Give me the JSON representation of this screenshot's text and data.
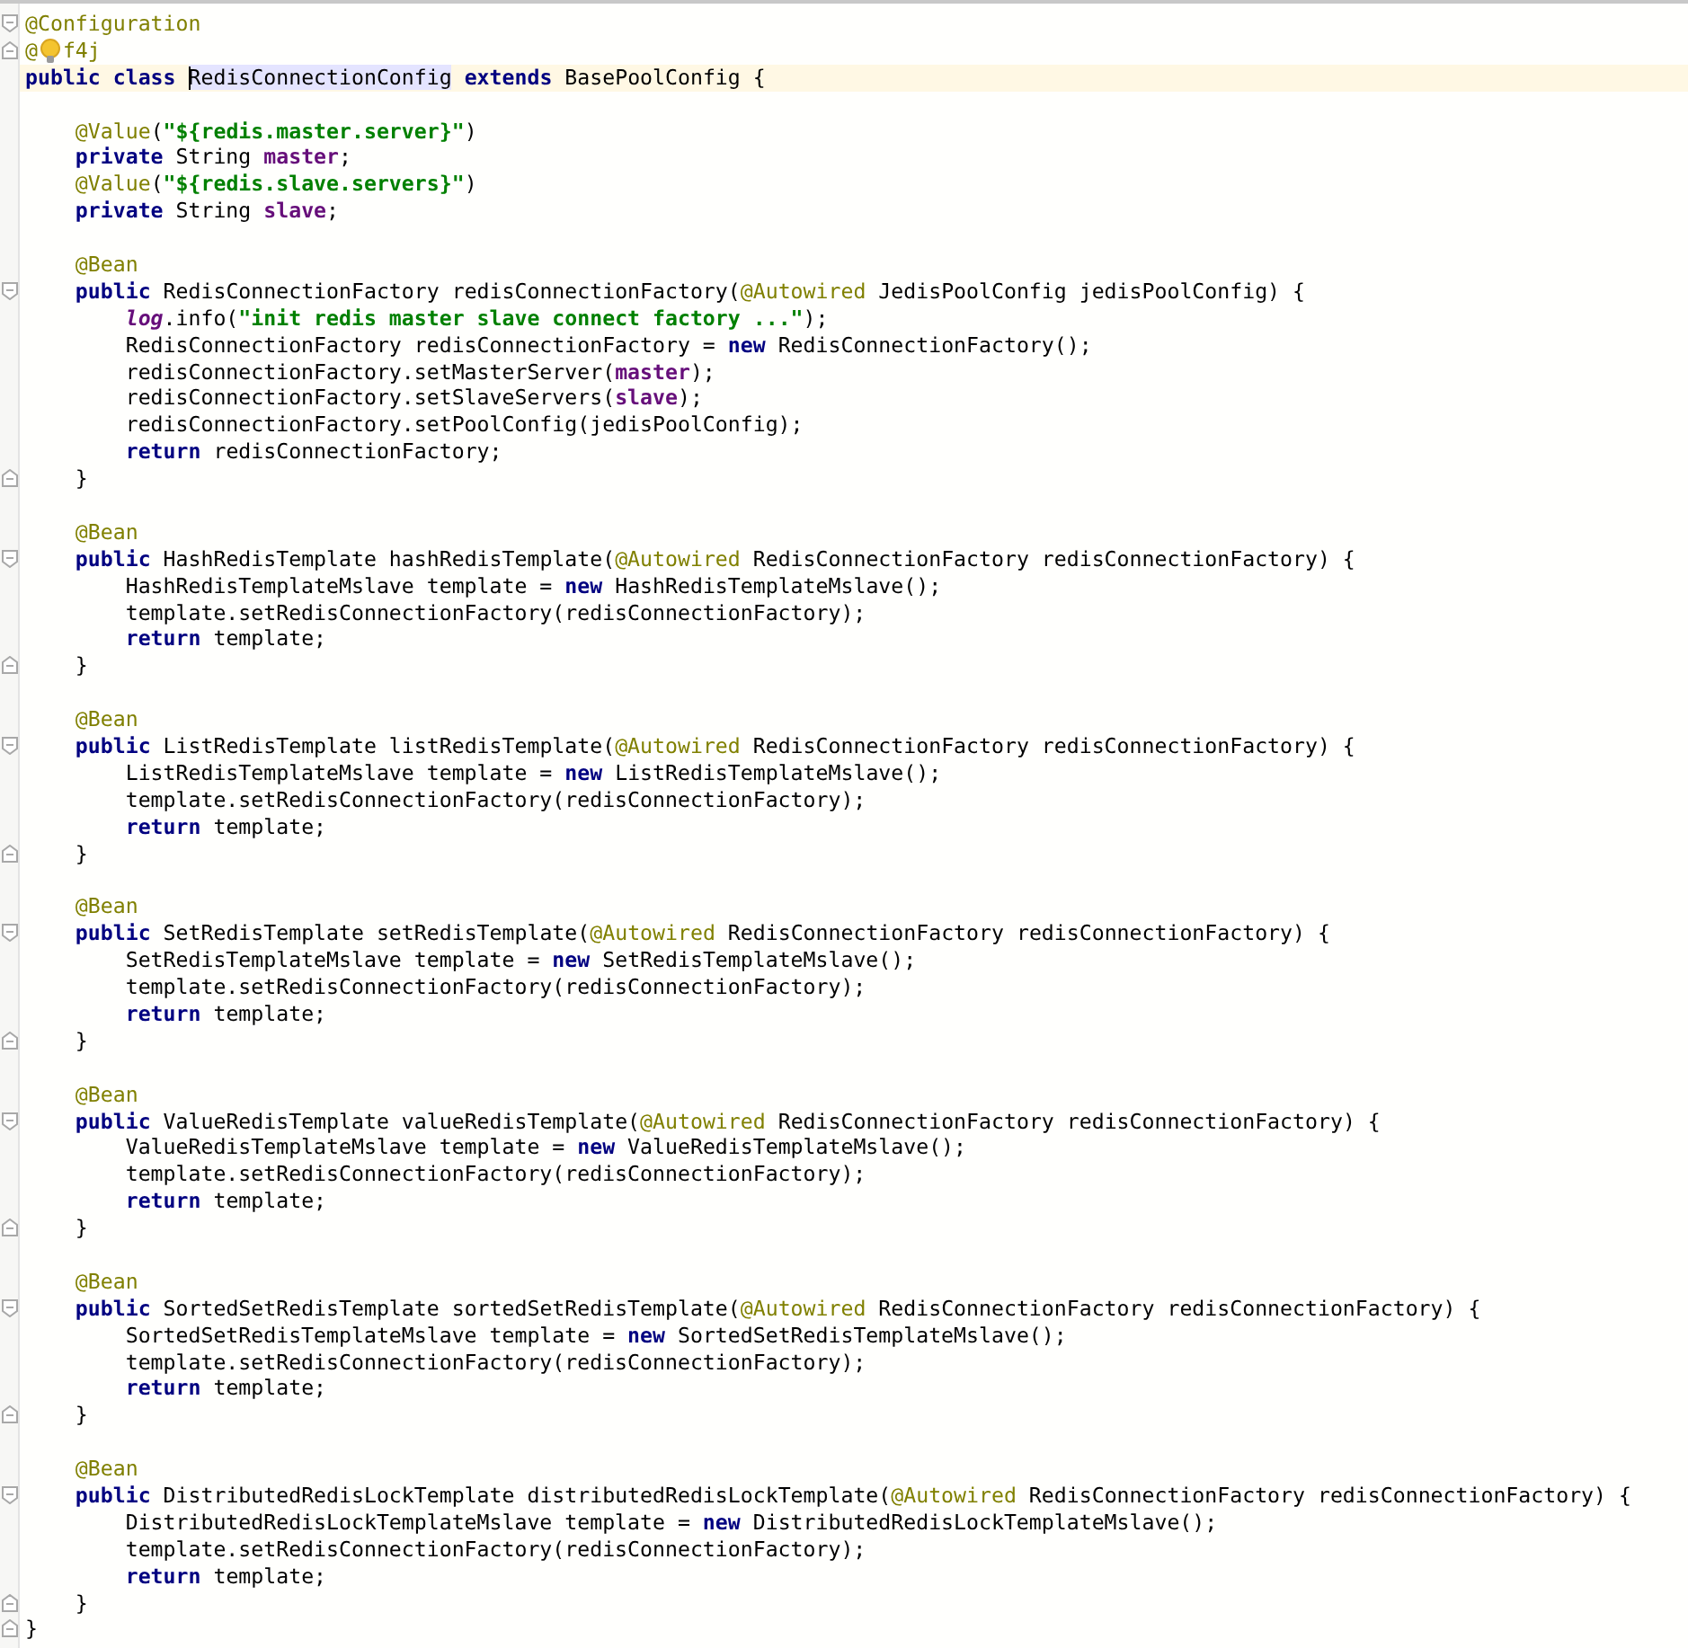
{
  "editor": {
    "lines": [
      {
        "kind": "fold_start",
        "tokens": [
          {
            "kind": "ann",
            "text": "@Configuration"
          }
        ]
      },
      {
        "kind": "fold_end",
        "tokens": [
          {
            "kind": "ann",
            "text": "@"
          },
          {
            "kind": "bulb"
          },
          {
            "kind": "ann",
            "text": "f4j"
          }
        ]
      },
      {
        "kind": "code",
        "current": true,
        "tokens": [
          {
            "kind": "kw",
            "text": "public class "
          },
          {
            "kind": "caret"
          },
          {
            "kind": "hl",
            "text": "RedisConnectionConfig"
          },
          {
            "kind": "kw",
            "text": " extends "
          },
          {
            "kind": "plain",
            "text": "BasePoolConfig {"
          }
        ]
      },
      {
        "kind": "blank"
      },
      {
        "kind": "code",
        "tokens": [
          {
            "kind": "ann",
            "text": "    @Value"
          },
          {
            "kind": "plain",
            "text": "("
          },
          {
            "kind": "str",
            "text": "\"${redis.master.server}\""
          },
          {
            "kind": "plain",
            "text": ")"
          }
        ]
      },
      {
        "kind": "code",
        "tokens": [
          {
            "kind": "kw",
            "text": "    private"
          },
          {
            "kind": "plain",
            "text": " String "
          },
          {
            "kind": "field",
            "text": "master"
          },
          {
            "kind": "plain",
            "text": ";"
          }
        ]
      },
      {
        "kind": "code",
        "tokens": [
          {
            "kind": "ann",
            "text": "    @Value"
          },
          {
            "kind": "plain",
            "text": "("
          },
          {
            "kind": "str",
            "text": "\"${redis.slave.servers}\""
          },
          {
            "kind": "plain",
            "text": ")"
          }
        ]
      },
      {
        "kind": "code",
        "tokens": [
          {
            "kind": "kw",
            "text": "    private"
          },
          {
            "kind": "plain",
            "text": " String "
          },
          {
            "kind": "field",
            "text": "slave"
          },
          {
            "kind": "plain",
            "text": ";"
          }
        ]
      },
      {
        "kind": "blank"
      },
      {
        "kind": "code",
        "tokens": [
          {
            "kind": "ann",
            "text": "    @Bean"
          }
        ]
      },
      {
        "kind": "fold_start",
        "tokens": [
          {
            "kind": "kw",
            "text": "    public"
          },
          {
            "kind": "plain",
            "text": " RedisConnectionFactory redisConnectionFactory("
          },
          {
            "kind": "ann",
            "text": "@Autowired"
          },
          {
            "kind": "plain",
            "text": " JedisPoolConfig jedisPoolConfig) {"
          }
        ]
      },
      {
        "kind": "code",
        "tokens": [
          {
            "kind": "log",
            "text": "        log"
          },
          {
            "kind": "plain",
            "text": ".info("
          },
          {
            "kind": "str",
            "text": "\"init redis master slave connect factory ...\""
          },
          {
            "kind": "plain",
            "text": ");"
          }
        ]
      },
      {
        "kind": "code",
        "tokens": [
          {
            "kind": "plain",
            "text": "        RedisConnectionFactory redisConnectionFactory = "
          },
          {
            "kind": "kw",
            "text": "new"
          },
          {
            "kind": "plain",
            "text": " RedisConnectionFactory();"
          }
        ]
      },
      {
        "kind": "code",
        "tokens": [
          {
            "kind": "plain",
            "text": "        redisConnectionFactory.setMasterServer("
          },
          {
            "kind": "field",
            "text": "master"
          },
          {
            "kind": "plain",
            "text": ");"
          }
        ]
      },
      {
        "kind": "code",
        "tokens": [
          {
            "kind": "plain",
            "text": "        redisConnectionFactory.setSlaveServers("
          },
          {
            "kind": "field",
            "text": "slave"
          },
          {
            "kind": "plain",
            "text": ");"
          }
        ]
      },
      {
        "kind": "code",
        "tokens": [
          {
            "kind": "plain",
            "text": "        redisConnectionFactory.setPoolConfig(jedisPoolConfig);"
          }
        ]
      },
      {
        "kind": "code",
        "tokens": [
          {
            "kind": "kw",
            "text": "        return"
          },
          {
            "kind": "plain",
            "text": " redisConnectionFactory;"
          }
        ]
      },
      {
        "kind": "fold_end",
        "tokens": [
          {
            "kind": "plain",
            "text": "    }"
          }
        ]
      },
      {
        "kind": "blank"
      },
      {
        "kind": "code",
        "tokens": [
          {
            "kind": "ann",
            "text": "    @Bean"
          }
        ]
      },
      {
        "kind": "fold_start",
        "tokens": [
          {
            "kind": "kw",
            "text": "    public"
          },
          {
            "kind": "plain",
            "text": " HashRedisTemplate hashRedisTemplate("
          },
          {
            "kind": "ann",
            "text": "@Autowired"
          },
          {
            "kind": "plain",
            "text": " RedisConnectionFactory redisConnectionFactory) {"
          }
        ]
      },
      {
        "kind": "code",
        "tokens": [
          {
            "kind": "plain",
            "text": "        HashRedisTemplateMslave template = "
          },
          {
            "kind": "kw",
            "text": "new"
          },
          {
            "kind": "plain",
            "text": " HashRedisTemplateMslave();"
          }
        ]
      },
      {
        "kind": "code",
        "tokens": [
          {
            "kind": "plain",
            "text": "        template.setRedisConnectionFactory(redisConnectionFactory);"
          }
        ]
      },
      {
        "kind": "code",
        "tokens": [
          {
            "kind": "kw",
            "text": "        return"
          },
          {
            "kind": "plain",
            "text": " template;"
          }
        ]
      },
      {
        "kind": "fold_end",
        "tokens": [
          {
            "kind": "plain",
            "text": "    }"
          }
        ]
      },
      {
        "kind": "blank"
      },
      {
        "kind": "code",
        "tokens": [
          {
            "kind": "ann",
            "text": "    @Bean"
          }
        ]
      },
      {
        "kind": "fold_start",
        "tokens": [
          {
            "kind": "kw",
            "text": "    public"
          },
          {
            "kind": "plain",
            "text": " ListRedisTemplate listRedisTemplate("
          },
          {
            "kind": "ann",
            "text": "@Autowired"
          },
          {
            "kind": "plain",
            "text": " RedisConnectionFactory redisConnectionFactory) {"
          }
        ]
      },
      {
        "kind": "code",
        "tokens": [
          {
            "kind": "plain",
            "text": "        ListRedisTemplateMslave template = "
          },
          {
            "kind": "kw",
            "text": "new"
          },
          {
            "kind": "plain",
            "text": " ListRedisTemplateMslave();"
          }
        ]
      },
      {
        "kind": "code",
        "tokens": [
          {
            "kind": "plain",
            "text": "        template.setRedisConnectionFactory(redisConnectionFactory);"
          }
        ]
      },
      {
        "kind": "code",
        "tokens": [
          {
            "kind": "kw",
            "text": "        return"
          },
          {
            "kind": "plain",
            "text": " template;"
          }
        ]
      },
      {
        "kind": "fold_end",
        "tokens": [
          {
            "kind": "plain",
            "text": "    }"
          }
        ]
      },
      {
        "kind": "blank"
      },
      {
        "kind": "code",
        "tokens": [
          {
            "kind": "ann",
            "text": "    @Bean"
          }
        ]
      },
      {
        "kind": "fold_start",
        "tokens": [
          {
            "kind": "kw",
            "text": "    public"
          },
          {
            "kind": "plain",
            "text": " SetRedisTemplate setRedisTemplate("
          },
          {
            "kind": "ann",
            "text": "@Autowired"
          },
          {
            "kind": "plain",
            "text": " RedisConnectionFactory redisConnectionFactory) {"
          }
        ]
      },
      {
        "kind": "code",
        "tokens": [
          {
            "kind": "plain",
            "text": "        SetRedisTemplateMslave template = "
          },
          {
            "kind": "kw",
            "text": "new"
          },
          {
            "kind": "plain",
            "text": " SetRedisTemplateMslave();"
          }
        ]
      },
      {
        "kind": "code",
        "tokens": [
          {
            "kind": "plain",
            "text": "        template.setRedisConnectionFactory(redisConnectionFactory);"
          }
        ]
      },
      {
        "kind": "code",
        "tokens": [
          {
            "kind": "kw",
            "text": "        return"
          },
          {
            "kind": "plain",
            "text": " template;"
          }
        ]
      },
      {
        "kind": "fold_end",
        "tokens": [
          {
            "kind": "plain",
            "text": "    }"
          }
        ]
      },
      {
        "kind": "blank"
      },
      {
        "kind": "code",
        "tokens": [
          {
            "kind": "ann",
            "text": "    @Bean"
          }
        ]
      },
      {
        "kind": "fold_start",
        "tokens": [
          {
            "kind": "kw",
            "text": "    public"
          },
          {
            "kind": "plain",
            "text": " ValueRedisTemplate valueRedisTemplate("
          },
          {
            "kind": "ann",
            "text": "@Autowired"
          },
          {
            "kind": "plain",
            "text": " RedisConnectionFactory redisConnectionFactory) {"
          }
        ]
      },
      {
        "kind": "code",
        "tokens": [
          {
            "kind": "plain",
            "text": "        ValueRedisTemplateMslave template = "
          },
          {
            "kind": "kw",
            "text": "new"
          },
          {
            "kind": "plain",
            "text": " ValueRedisTemplateMslave();"
          }
        ]
      },
      {
        "kind": "code",
        "tokens": [
          {
            "kind": "plain",
            "text": "        template.setRedisConnectionFactory(redisConnectionFactory);"
          }
        ]
      },
      {
        "kind": "code",
        "tokens": [
          {
            "kind": "kw",
            "text": "        return"
          },
          {
            "kind": "plain",
            "text": " template;"
          }
        ]
      },
      {
        "kind": "fold_end",
        "tokens": [
          {
            "kind": "plain",
            "text": "    }"
          }
        ]
      },
      {
        "kind": "blank"
      },
      {
        "kind": "code",
        "tokens": [
          {
            "kind": "ann",
            "text": "    @Bean"
          }
        ]
      },
      {
        "kind": "fold_start",
        "tokens": [
          {
            "kind": "kw",
            "text": "    public"
          },
          {
            "kind": "plain",
            "text": " SortedSetRedisTemplate sortedSetRedisTemplate("
          },
          {
            "kind": "ann",
            "text": "@Autowired"
          },
          {
            "kind": "plain",
            "text": " RedisConnectionFactory redisConnectionFactory) {"
          }
        ]
      },
      {
        "kind": "code",
        "tokens": [
          {
            "kind": "plain",
            "text": "        SortedSetRedisTemplateMslave template = "
          },
          {
            "kind": "kw",
            "text": "new"
          },
          {
            "kind": "plain",
            "text": " SortedSetRedisTemplateMslave();"
          }
        ]
      },
      {
        "kind": "code",
        "tokens": [
          {
            "kind": "plain",
            "text": "        template.setRedisConnectionFactory(redisConnectionFactory);"
          }
        ]
      },
      {
        "kind": "code",
        "tokens": [
          {
            "kind": "kw",
            "text": "        return"
          },
          {
            "kind": "plain",
            "text": " template;"
          }
        ]
      },
      {
        "kind": "fold_end",
        "tokens": [
          {
            "kind": "plain",
            "text": "    }"
          }
        ]
      },
      {
        "kind": "blank"
      },
      {
        "kind": "code",
        "tokens": [
          {
            "kind": "ann",
            "text": "    @Bean"
          }
        ]
      },
      {
        "kind": "fold_start",
        "tokens": [
          {
            "kind": "kw",
            "text": "    public"
          },
          {
            "kind": "plain",
            "text": " DistributedRedisLockTemplate distributedRedisLockTemplate("
          },
          {
            "kind": "ann",
            "text": "@Autowired"
          },
          {
            "kind": "plain",
            "text": " RedisConnectionFactory redisConnectionFactory) {"
          }
        ]
      },
      {
        "kind": "code",
        "tokens": [
          {
            "kind": "plain",
            "text": "        DistributedRedisLockTemplateMslave template = "
          },
          {
            "kind": "kw",
            "text": "new"
          },
          {
            "kind": "plain",
            "text": " DistributedRedisLockTemplateMslave();"
          }
        ]
      },
      {
        "kind": "code",
        "tokens": [
          {
            "kind": "plain",
            "text": "        template.setRedisConnectionFactory(redisConnectionFactory);"
          }
        ]
      },
      {
        "kind": "code",
        "tokens": [
          {
            "kind": "kw",
            "text": "        return"
          },
          {
            "kind": "plain",
            "text": " template;"
          }
        ]
      },
      {
        "kind": "fold_end",
        "tokens": [
          {
            "kind": "plain",
            "text": "    }"
          }
        ]
      },
      {
        "kind": "fold_end",
        "tokens": [
          {
            "kind": "plain",
            "text": "}"
          }
        ]
      }
    ]
  }
}
